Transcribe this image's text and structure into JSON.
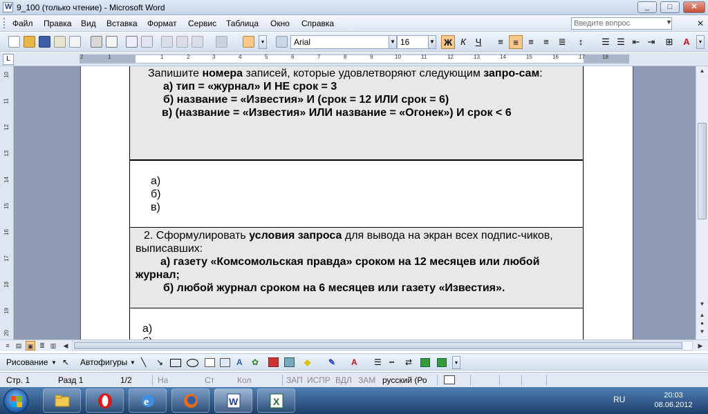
{
  "window": {
    "title": "9_100 (только чтение) - Microsoft Word",
    "minimize": "_",
    "maximize": "□",
    "close": "✕"
  },
  "menu": {
    "items": [
      "Файл",
      "Правка",
      "Вид",
      "Вставка",
      "Формат",
      "Сервис",
      "Таблица",
      "Окно",
      "Справка"
    ],
    "ask_placeholder": "Введите вопрос"
  },
  "toolbar": {
    "font_name": "Arial",
    "font_size": "16",
    "bold_label": "Ж",
    "italic_label": "К",
    "underline_label": "Ч",
    "font_color_label": "A",
    "accent_color": "#f8c98a",
    "font_color": "#d01010"
  },
  "ruler": {
    "numbers": [
      "2",
      "1",
      "1",
      "2",
      "3",
      "4",
      "5",
      "6",
      "7",
      "8",
      "9",
      "10",
      "11",
      "12",
      "13",
      "14",
      "15",
      "16",
      "17",
      "18"
    ],
    "vertical_numbers": [
      "10",
      "11",
      "12",
      "13",
      "14",
      "15",
      "16",
      "17",
      "18",
      "19",
      "20"
    ]
  },
  "document": {
    "block1": {
      "intro_pre": "Запишите ",
      "intro_bold1": "номера",
      "intro_mid": " записей, которые удовлетворяют следующим ",
      "intro_bold2": "запро-сам",
      "intro_post": ":",
      "item_a": "а) тип = «журнал» И НЕ срок = 3",
      "item_b": "б) название = «Известия» И (срок = 12 ИЛИ срок = 6)",
      "item_c": "в) (название = «Известия» ИЛИ название = «Огонек») И срок < 6"
    },
    "answers1": [
      "а)",
      "б)",
      "в)"
    ],
    "block2": {
      "intro_pre": "2. Сформулировать ",
      "intro_bold": "условия запроса",
      "intro_post": " для вывода на экран всех подпис-чиков, выписавших:",
      "item_a": "а) газету «Комсомольская правда» сроком  на 12 месяцев или любой журнал;",
      "item_b": "б) любой журнал сроком на 6 месяцев или газету «Известия»."
    },
    "answers2": [
      "а)",
      "б)"
    ]
  },
  "drawbar": {
    "draw_label": "Рисование",
    "autoshapes_label": "Автофигуры"
  },
  "status": {
    "page": "Стр. 1",
    "section": "Разд 1",
    "pages": "1/2",
    "at": "На",
    "line": "Ст",
    "col": "Кол",
    "rec": "ЗАП",
    "trk": "ИСПР",
    "ext": "ВДЛ",
    "ovr": "ЗАМ",
    "lang": "русский (Ро"
  },
  "taskbar": {
    "lang": "RU",
    "time": "20:03",
    "date": "08.06.2012"
  }
}
